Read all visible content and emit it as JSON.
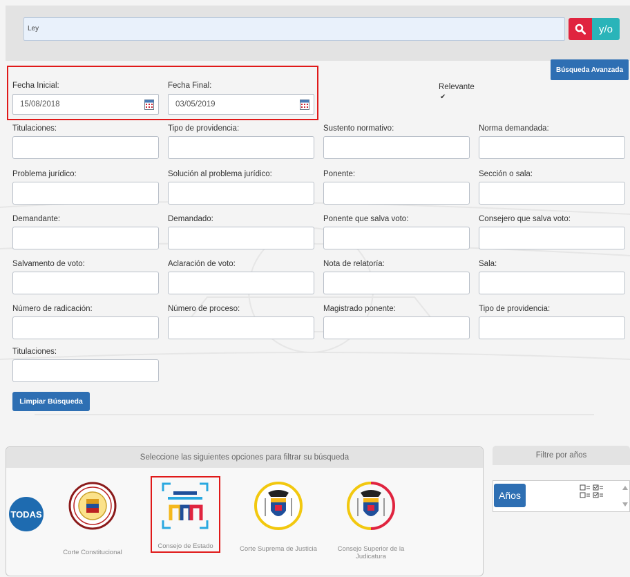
{
  "search": {
    "value": "Ley",
    "search_button_icon": "search-icon",
    "operator_label": "y/o"
  },
  "advanced_button": "Búsqueda Avanzada",
  "dates": {
    "start_label": "Fecha Inicial:",
    "start_value": "15/08/2018",
    "end_label": "Fecha Final:",
    "end_value": "03/05/2019",
    "calendar_icon": "calendar-icon"
  },
  "relevante": {
    "label": "Relevante",
    "checked": true
  },
  "fields": [
    {
      "label": "Titulaciones:"
    },
    {
      "label": "Tipo de providencia:"
    },
    {
      "label": "Sustento normativo:"
    },
    {
      "label": "Norma demandada:"
    },
    {
      "label": "Problema jurídico:"
    },
    {
      "label": "Solución al problema jurídico:"
    },
    {
      "label": "Ponente:"
    },
    {
      "label": "Sección o sala:"
    },
    {
      "label": "Demandante:"
    },
    {
      "label": "Demandado:"
    },
    {
      "label": "Ponente que salva voto:"
    },
    {
      "label": "Consejero que salva voto:"
    },
    {
      "label": "Salvamento de voto:"
    },
    {
      "label": "Aclaración de voto:"
    },
    {
      "label": "Nota de relatoría:"
    },
    {
      "label": "Sala:"
    },
    {
      "label": "Número de radicación:"
    },
    {
      "label": "Número de proceso:"
    },
    {
      "label": "Magistrado ponente:"
    },
    {
      "label": "Tipo de providencia:"
    },
    {
      "label": "Titulaciones:"
    }
  ],
  "clear_button": "Limpiar Búsqueda",
  "filter": {
    "header": "Seleccione las siguientes opciones para filtrar su búsqueda",
    "todas_label": "TODAS",
    "courts": [
      {
        "caption": "Corte Constitucional",
        "icon": "corte-constitucional-seal-icon"
      },
      {
        "caption": "Consejo de Estado",
        "icon": "consejo-de-estado-logo-icon"
      },
      {
        "caption": "Corte Suprema de Justicia",
        "icon": "corte-suprema-coat-of-arms-icon"
      },
      {
        "caption": "Consejo Superior de la Judicatura",
        "icon": "consejo-superior-coat-of-arms-icon"
      }
    ]
  },
  "years": {
    "header": "Filtre por años",
    "button": "Años",
    "colors": {
      "primary": "#2e6fb3",
      "danger": "#e0243f",
      "teal": "#2ab4b9",
      "highlight": "#e01919"
    }
  }
}
